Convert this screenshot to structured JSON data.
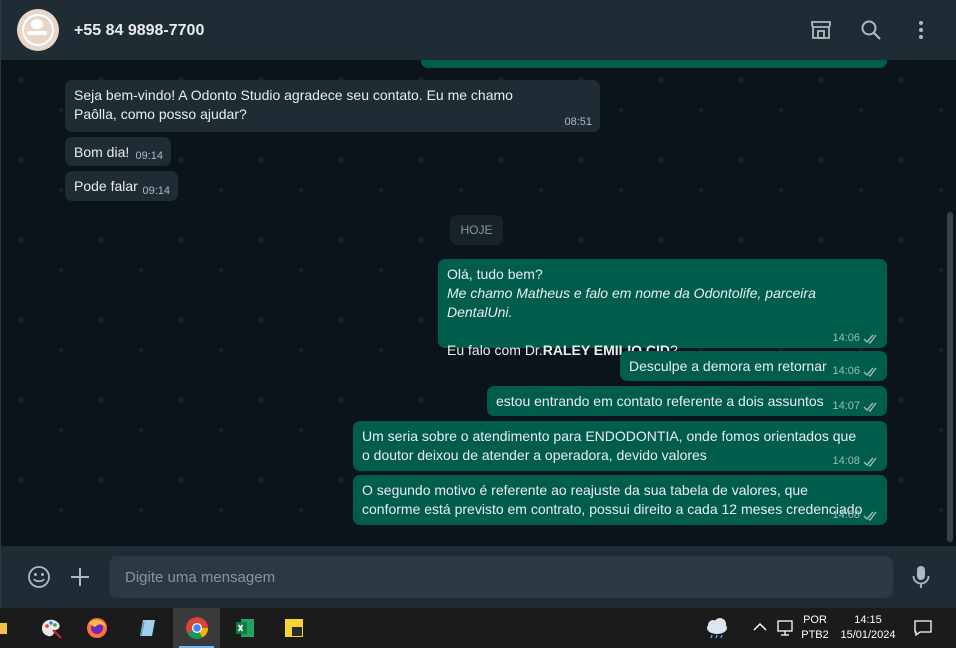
{
  "header": {
    "contact_name": "+55 84 9898-7700",
    "icons": [
      "store-icon",
      "search-icon",
      "menu-icon"
    ]
  },
  "messages": [
    {
      "direction": "incoming",
      "text": "Seja bem-vindo! A Odonto Studio agradece seu contato. Eu me chamo Paôlla, como posso ajudar?",
      "time": "08:51"
    },
    {
      "direction": "incoming",
      "text": "Bom dia!",
      "time": "09:14"
    },
    {
      "direction": "incoming",
      "text": "Pode falar",
      "time": "09:14"
    },
    {
      "direction": "outgoing",
      "line1": "Olá, tudo bem?",
      "line2": "Me chamo Matheus e falo em nome da Odontolife, parceira DentalUni.",
      "line3_prefix": "Eu falo com Dr.",
      "line3_bold": "RALEY EMILIO CID",
      "line3_suffix": "?",
      "time": "14:06"
    },
    {
      "direction": "outgoing",
      "text": "Desculpe a demora em retornar",
      "time": "14:06"
    },
    {
      "direction": "outgoing",
      "text": "estou entrando em contato referente a dois assuntos",
      "time": "14:07"
    },
    {
      "direction": "outgoing",
      "text": "Um seria sobre o atendimento para ENDODONTIA, onde fomos orientados que o doutor deixou de atender a operadora, devido valores",
      "time": "14:08"
    },
    {
      "direction": "outgoing",
      "text": "O segundo motivo é referente ao reajuste da sua tabela de valores, que conforme está previsto em contrato, possui direito a cada 12 meses credenciado",
      "time": "14:08"
    }
  ],
  "day_divider": "HOJE",
  "composer": {
    "placeholder": "Digite uma mensagem"
  },
  "taskbar": {
    "language": "POR",
    "layout": "PTB2",
    "time": "14:15",
    "date": "15/01/2024"
  },
  "colors": {
    "incoming_bubble": "#202c33",
    "outgoing_bubble": "#005c4b",
    "header": "#202c33",
    "background": "#0b141a"
  }
}
